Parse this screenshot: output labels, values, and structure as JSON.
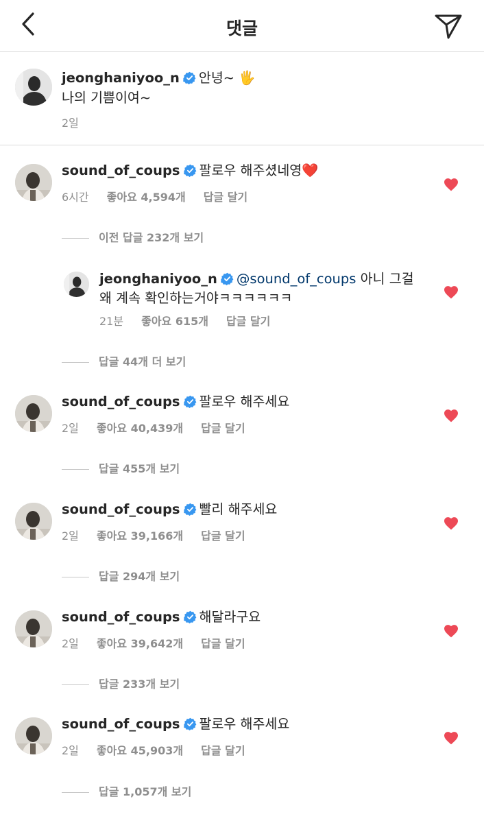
{
  "header": {
    "title": "댓글"
  },
  "caption": {
    "username": "jeonghaniyoo_n",
    "text_line1": "안녕~ 🖐",
    "text_line2": "나의 기쁨이여~",
    "time": "2일"
  },
  "comments": [
    {
      "username": "sound_of_coups",
      "text": "팔로우 해주셨네영❤️",
      "time": "6시간",
      "likes": "좋아요 4,594개",
      "reply": "답글 달기",
      "view_replies": "이전 답글 232개 보기"
    },
    {
      "username": "sound_of_coups",
      "text": "팔로우 해주세요",
      "time": "2일",
      "likes": "좋아요 40,439개",
      "reply": "답글 달기",
      "view_replies": "답글 455개 보기"
    },
    {
      "username": "sound_of_coups",
      "text": "빨리 해주세요",
      "time": "2일",
      "likes": "좋아요 39,166개",
      "reply": "답글 달기",
      "view_replies": "답글 294개 보기"
    },
    {
      "username": "sound_of_coups",
      "text": "해달라구요",
      "time": "2일",
      "likes": "좋아요 39,642개",
      "reply": "답글 달기",
      "view_replies": "답글 233개 보기"
    },
    {
      "username": "sound_of_coups",
      "text": "팔로우 해주세요",
      "time": "2일",
      "likes": "좋아요 45,903개",
      "reply": "답글 달기",
      "view_replies": "답글 1,057개 보기"
    }
  ],
  "reply": {
    "username": "jeonghaniyoo_n",
    "mention": "@sound_of_coups",
    "text_line1": " 아니 그걸",
    "text_line2": "왜 계속 확인하는거야ㅋㅋㅋㅋㅋㅋ",
    "time": "21분",
    "likes": "좋아요 615개",
    "reply": "답글 달기",
    "more_replies": "답글 44개 더 보기"
  },
  "icons": {
    "back": "chevron-left-icon",
    "send": "paper-plane-icon",
    "verified": "verified-badge-icon",
    "like": "heart-icon"
  },
  "colors": {
    "heart": "#ed4956",
    "verified": "#3897f0",
    "mention": "#00376b",
    "meta": "#8e8e8e"
  }
}
